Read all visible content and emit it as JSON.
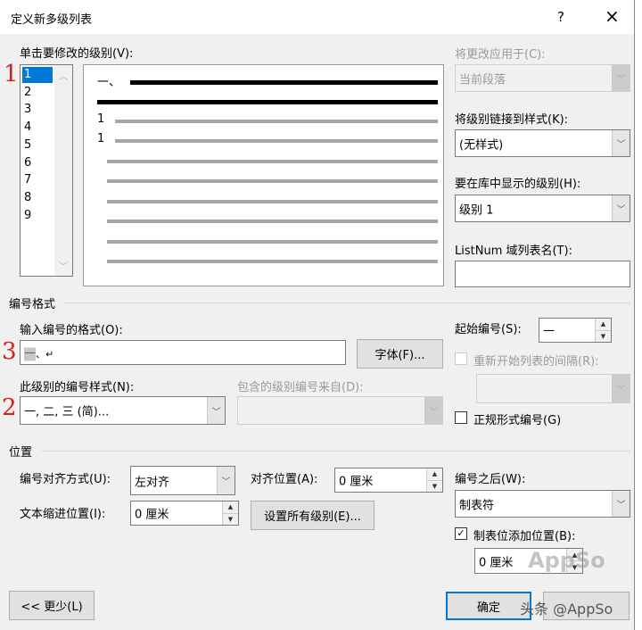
{
  "window": {
    "title": "定义新多级列表",
    "help": "?",
    "close": "×"
  },
  "levels": {
    "label": "单击要修改的级别(V):",
    "items": [
      "1",
      "2",
      "3",
      "4",
      "5",
      "6",
      "7",
      "8",
      "9"
    ],
    "selected": "1"
  },
  "preview": {
    "level1_prefix": "一、",
    "level_numbers": [
      "1",
      "1"
    ]
  },
  "apply_to": {
    "label": "将更改应用于(C):",
    "value": "当前段落"
  },
  "link_style": {
    "label": "将级别链接到样式(K):",
    "value": "(无样式)"
  },
  "gallery_level": {
    "label": "要在库中显示的级别(H):",
    "value": "级别 1"
  },
  "listnum": {
    "label": "ListNum 域列表名(T):",
    "value": ""
  },
  "number_format": {
    "section": "编号格式",
    "format_label": "输入编号的格式(O):",
    "format_highlight": "一",
    "format_rest": "、↵",
    "font_button": "字体(F)...",
    "start_label": "起始编号(S):",
    "start_value": "一",
    "restart_label": "重新开始列表的间隔(R):",
    "style_label": "此级别的编号样式(N):",
    "style_value": "一, 二, 三 (简)...",
    "include_label": "包含的级别编号来自(D):",
    "legal_label": "正规形式编号(G)"
  },
  "position": {
    "section": "位置",
    "align_label": "编号对齐方式(U):",
    "align_value": "左对齐",
    "at_label": "对齐位置(A):",
    "at_value": "0 厘米",
    "indent_label": "文本缩进位置(I):",
    "indent_value": "0 厘米",
    "set_all_button": "设置所有级别(E)...",
    "follow_label": "编号之后(W):",
    "follow_value": "制表符",
    "tab_label": "制表位添加位置(B):",
    "tab_checked": true,
    "tab_value": "0 厘米"
  },
  "buttons": {
    "less": "<< 更少(L)",
    "ok": "确定",
    "cancel": "取消"
  },
  "annotations": [
    "1",
    "3",
    "2"
  ],
  "watermark": {
    "logo": "AppSo",
    "caption": "头条 @AppSo"
  }
}
